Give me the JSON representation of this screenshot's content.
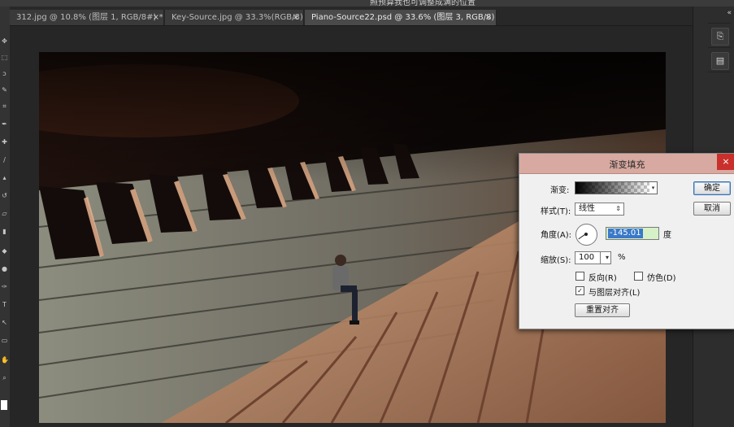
{
  "window": {
    "title": "照预算我也可调整成满的位置"
  },
  "tabs": [
    {
      "label": "312.jpg @ 10.8% (图层 1, RGB/8#) *",
      "close": "×"
    },
    {
      "label": "Key-Source.jpg @ 33.3%(RGB/8)",
      "close": "×"
    },
    {
      "label": "Piano-Source22.psd @ 33.6% (图层 3, RGB/8) *",
      "close": "×"
    }
  ],
  "right_panel": {
    "collapse": "«"
  },
  "dialog": {
    "title": "渐变填充",
    "close": "×",
    "gradient_label": "渐变:",
    "style_label": "样式(T):",
    "style_value": "线性",
    "angle_label": "角度(A):",
    "angle_value": "-145.01",
    "angle_unit": "度",
    "scale_label": "缩放(S):",
    "scale_value": "100",
    "scale_unit": "%",
    "reverse_label": "反向(R)",
    "dither_label": "仿色(D)",
    "align_label": "与图层对齐(L)",
    "reset_align_button": "重置对齐",
    "ok_button": "确定",
    "cancel_button": "取消",
    "checks": {
      "reverse": false,
      "dither": false,
      "align": true
    }
  },
  "colors": {
    "app_bg": "#282828",
    "dialog_title_bg": "#d8a9a0",
    "close_red": "#c9302c",
    "angle_field_bg": "#d6f0c8"
  }
}
